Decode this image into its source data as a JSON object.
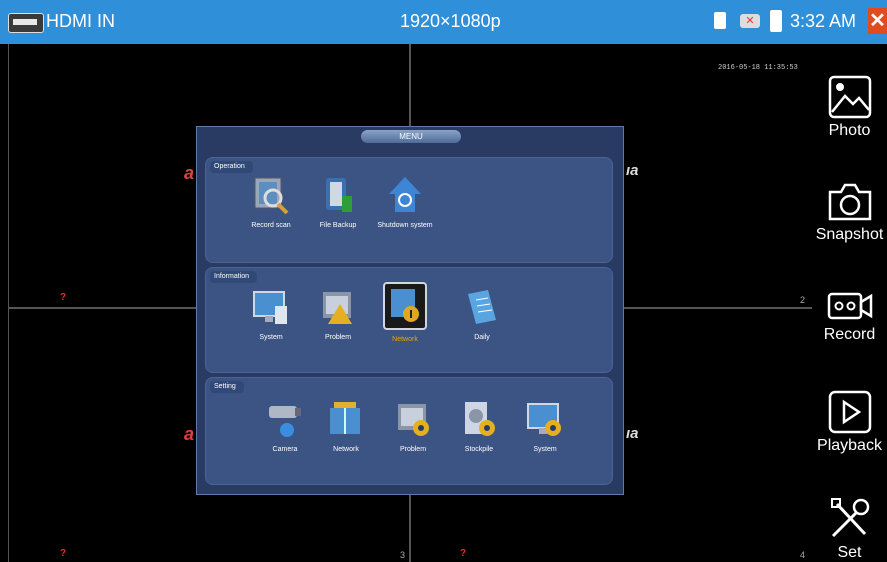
{
  "status_bar": {
    "title": "HDMI IN",
    "resolution": "1920×1080p",
    "time": "3:32 AM",
    "close_glyph": "✕",
    "icons": [
      "hdmi-icon",
      "sd-card-icon",
      "no-network-icon",
      "battery-icon",
      "close-icon"
    ]
  },
  "video": {
    "timestamp": "2016-05-18 11:35:53",
    "channel_numbers": [
      "2",
      "3",
      "4"
    ]
  },
  "menu": {
    "title": "MENU",
    "sections": [
      {
        "label": "Operation",
        "items": [
          {
            "label": "Record scan",
            "icon": "record-scan-icon"
          },
          {
            "label": "File Backup",
            "icon": "file-backup-icon"
          },
          {
            "label": "Shutdown system",
            "icon": "shutdown-icon"
          }
        ]
      },
      {
        "label": "Information",
        "items": [
          {
            "label": "System",
            "icon": "system-info-icon"
          },
          {
            "label": "Problem",
            "icon": "problem-icon"
          },
          {
            "label": "Network",
            "icon": "network-info-icon",
            "selected": true
          },
          {
            "label": "Daily",
            "icon": "daily-log-icon"
          }
        ]
      },
      {
        "label": "Setting",
        "items": [
          {
            "label": "Camera",
            "icon": "camera-icon"
          },
          {
            "label": "Network",
            "icon": "network-setting-icon"
          },
          {
            "label": "Problem",
            "icon": "problem-setting-icon"
          },
          {
            "label": "Stockpile",
            "icon": "stockpile-icon"
          },
          {
            "label": "System",
            "icon": "system-setting-icon"
          }
        ]
      }
    ]
  },
  "sidebar": {
    "items": [
      {
        "label": "Photo",
        "icon": "photo-icon"
      },
      {
        "label": "Snapshot",
        "icon": "snapshot-icon"
      },
      {
        "label": "Record",
        "icon": "record-icon"
      },
      {
        "label": "Playback",
        "icon": "playback-icon"
      },
      {
        "label": "Set",
        "icon": "settings-tools-icon"
      }
    ]
  },
  "colors": {
    "status_bar": "#2f8fd8",
    "menu_bg": "#2a3b63",
    "section_bg": "#3b5483",
    "selected_label": "#e6a800",
    "close_button": "#e24b1d"
  }
}
